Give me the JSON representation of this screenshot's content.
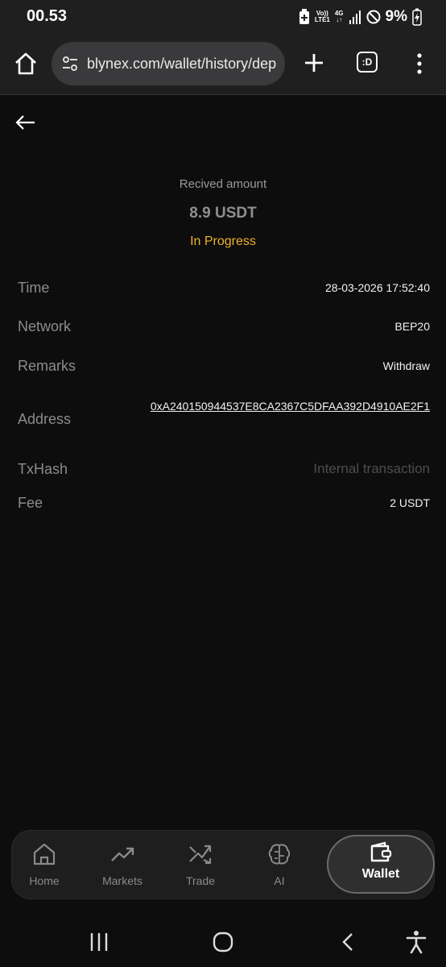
{
  "status_bar": {
    "time": "00.53",
    "volte_line1": "Vo))",
    "volte_line2": "LTE1",
    "network_type": "4G",
    "battery": "9%"
  },
  "browser": {
    "url": "blynex.com/wallet/history/dep",
    "tabs_label": ":D"
  },
  "detail": {
    "amount_label": "Recived amount",
    "amount_value": "8.9 USDT",
    "status": "In Progress",
    "status_color": "#f0b12e",
    "rows": [
      {
        "key": "Time",
        "value": "28-03-2026 17:52:40"
      },
      {
        "key": "Network",
        "value": "BEP20"
      },
      {
        "key": "Remarks",
        "value": "Withdraw"
      },
      {
        "key": "Address",
        "value": "0xA240150944537E8CA2367C5DFAA392D4910AE2F1"
      },
      {
        "key": "TxHash",
        "value": "Internal transaction"
      },
      {
        "key": "Fee",
        "value": "2 USDT"
      }
    ]
  },
  "bottom_nav": {
    "items": [
      {
        "label": "Home",
        "icon": "home-icon"
      },
      {
        "label": "Markets",
        "icon": "trending-up-icon"
      },
      {
        "label": "Trade",
        "icon": "shuffle-icon"
      },
      {
        "label": "AI",
        "icon": "brain-icon"
      },
      {
        "label": "Wallet",
        "icon": "wallet-icon",
        "active": true
      }
    ]
  }
}
